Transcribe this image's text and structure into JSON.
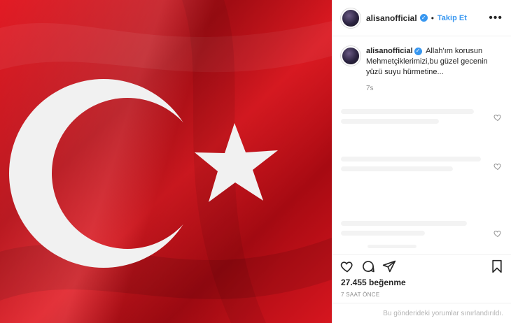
{
  "post": {
    "image_alt_icon": "turkish-flag",
    "colors": {
      "flag_red": "#c70d17",
      "flag_white": "#f3f3f3",
      "link_blue": "#3897f0",
      "text": "#262626",
      "muted": "#8e8e8e"
    }
  },
  "header": {
    "username": "alisanofficial",
    "separator": "•",
    "follow_label": "Takip Et",
    "more_label": "•••"
  },
  "caption": {
    "username": "alisanofficial",
    "text": "Allah'ım korusun Mehmetçiklerimizi,bu güzel gecenin yüzü suyu hürmetine...",
    "time": "7s"
  },
  "stats": {
    "likes": "27.455 beğenme",
    "timestamp": "7 SAAT ÖNCE"
  },
  "footer": {
    "comments_disabled": "Bu gönderideki yorumlar sınırlandırıldı."
  },
  "icons": {
    "verified": "verified-badge-icon",
    "like": "heart-icon",
    "comment": "comment-icon",
    "share": "share-icon",
    "save": "bookmark-icon"
  }
}
